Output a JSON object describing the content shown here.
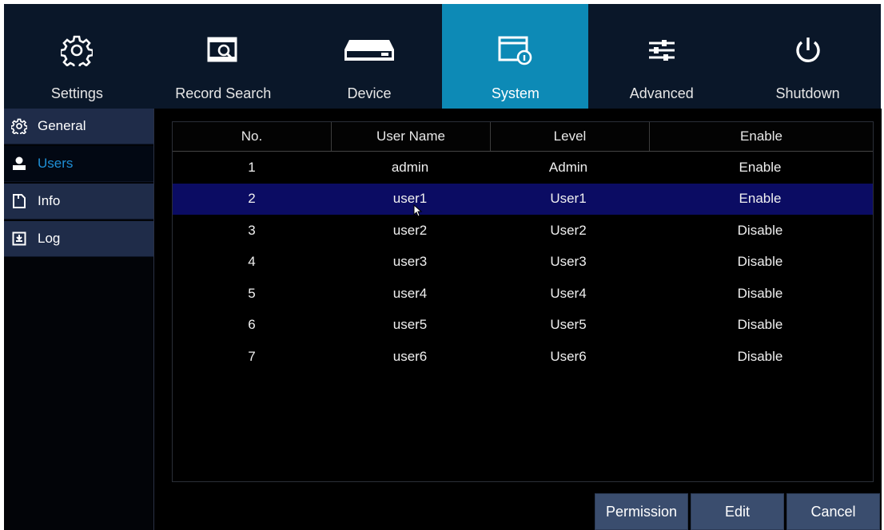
{
  "topnav": {
    "tabs": [
      {
        "label": "Settings",
        "icon": "gear-icon"
      },
      {
        "label": "Record Search",
        "icon": "record-search-icon"
      },
      {
        "label": "Device",
        "icon": "hard-drive-icon"
      },
      {
        "label": "System",
        "icon": "system-info-icon",
        "active": true
      },
      {
        "label": "Advanced",
        "icon": "sliders-icon"
      },
      {
        "label": "Shutdown",
        "icon": "power-icon"
      }
    ]
  },
  "sidebar": {
    "items": [
      {
        "label": "General",
        "icon": "gear-icon"
      },
      {
        "label": "Users",
        "icon": "user-icon",
        "active": true
      },
      {
        "label": "Info",
        "icon": "document-icon"
      },
      {
        "label": "Log",
        "icon": "log-icon"
      }
    ]
  },
  "table": {
    "headers": [
      "No.",
      "User Name",
      "Level",
      "Enable"
    ],
    "rows": [
      [
        "1",
        "admin",
        "Admin",
        "Enable"
      ],
      [
        "2",
        "user1",
        "User1",
        "Enable"
      ],
      [
        "3",
        "user2",
        "User2",
        "Disable"
      ],
      [
        "4",
        "user3",
        "User3",
        "Disable"
      ],
      [
        "5",
        "user4",
        "User4",
        "Disable"
      ],
      [
        "6",
        "user5",
        "User5",
        "Disable"
      ],
      [
        "7",
        "user6",
        "User6",
        "Disable"
      ]
    ],
    "selected_row": 2
  },
  "buttons": {
    "permission": "Permission",
    "edit": "Edit",
    "cancel": "Cancel"
  },
  "colors": {
    "active_tab": "#0d8ab6",
    "selected_row": "#0b0c63",
    "active_sidebar_text": "#1f8fd6",
    "button_bg": "#3a4d6e"
  }
}
